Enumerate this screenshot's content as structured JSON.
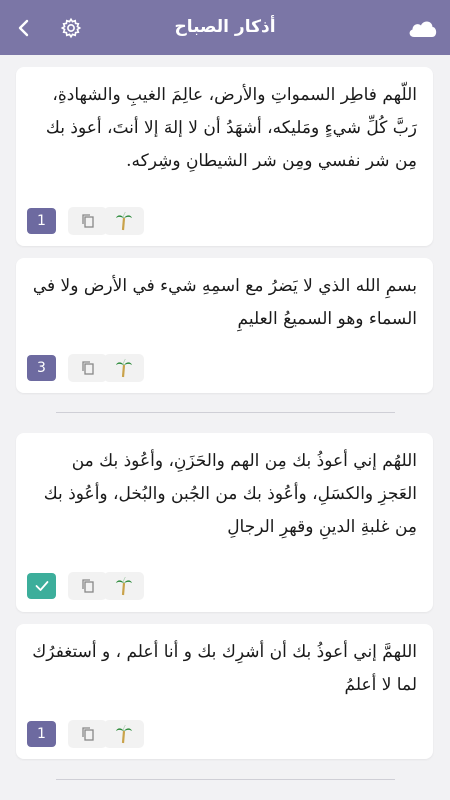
{
  "header": {
    "title": "أذكار الصباح",
    "background": "#7b76a6",
    "left_icons": [
      "chevron-left-icon",
      "gear-icon"
    ],
    "right_icon": "cloud-icon"
  },
  "cards": [
    {
      "text": "اللّهم فاطِر السمواتِ والأرض، عالِمَ الغيبِ والشهادةِ، رَبَّ كُلِّ شيءٍ ومَليكه، أشهَدُ أن لا إلهَ إلا أنتَ، أعوذ بك مِن شر نفسي ومِن شر الشيطانِ وشِركه.",
      "count": "1",
      "done": false
    },
    {
      "text": "بسمِ الله الذي لا يَضرُ مع اسمِهِ شيء في الأرض ولا في السماء وهو السميعُ العليمِ",
      "count": "3",
      "done": false
    },
    {
      "text": "اللهُم إني أعوذُ بك مِن الهم والحَزَنِ، وأعُوذ بك من العَجزِ والكسَلِ، وأعُوذ بك من الجُبن والبُخل، وأعُوذ بك مِن غلبةِ الدينِ وقهرِ الرجالِ",
      "count": "",
      "done": true
    },
    {
      "text": "اللهمَّ إني أعوذُ بك أن أشرِك بك و أنا أعلم ، و أستغفرُك لما لا أعلمُ",
      "count": "1",
      "done": false
    }
  ],
  "colors": {
    "count_button": "#6d6aa0",
    "done_button": "#3cae9b",
    "palm_trunk": "#c9a24a",
    "palm_leaves": "#2e8b3c"
  }
}
